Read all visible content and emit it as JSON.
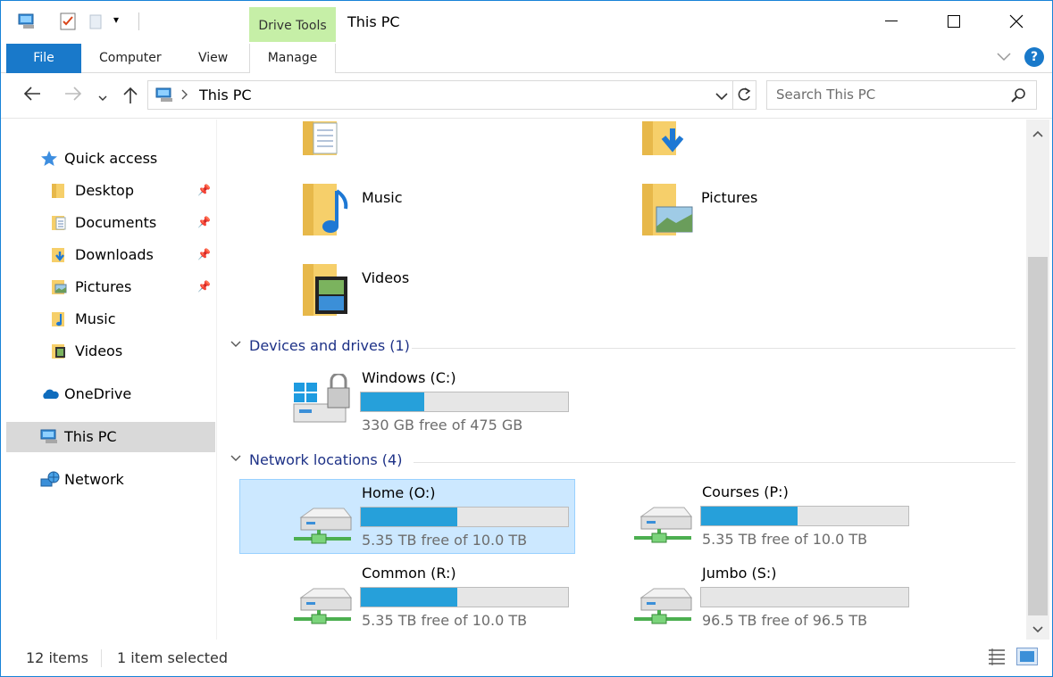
{
  "window": {
    "title": "This PC",
    "context_tab": "Drive Tools",
    "accent": "#1979ca",
    "context_color": "#c6efa7"
  },
  "ribbon": {
    "tabs": [
      {
        "label": "File"
      },
      {
        "label": "Computer"
      },
      {
        "label": "View"
      },
      {
        "label": "Manage"
      }
    ],
    "help": "?"
  },
  "address": {
    "path": "This PC",
    "search_placeholder": "Search This PC"
  },
  "sidebar": {
    "quick_access": "Quick access",
    "pinned": [
      {
        "label": "Desktop",
        "icon": "desktop-folder-icon"
      },
      {
        "label": "Documents",
        "icon": "documents-folder-icon"
      },
      {
        "label": "Downloads",
        "icon": "downloads-folder-icon"
      },
      {
        "label": "Pictures",
        "icon": "pictures-folder-icon"
      }
    ],
    "recent": [
      {
        "label": "Music",
        "icon": "music-folder-icon"
      },
      {
        "label": "Videos",
        "icon": "videos-folder-icon"
      }
    ],
    "onedrive": "OneDrive",
    "this_pc": "This PC",
    "network": "Network"
  },
  "content": {
    "folders": [
      {
        "label": "Music"
      },
      {
        "label": "Pictures"
      },
      {
        "label": "Videos"
      }
    ],
    "devices_header": "Devices and drives (1)",
    "devices": [
      {
        "name": "Windows (C:)",
        "free": "330 GB free of 475 GB",
        "used_fraction": 0.305
      }
    ],
    "network_header": "Network locations (4)",
    "network_drives": [
      {
        "name": "Home (O:)",
        "free": "5.35 TB free of 10.0 TB",
        "used_fraction": 0.465,
        "selected": true
      },
      {
        "name": "Courses (P:)",
        "free": "5.35 TB free of 10.0 TB",
        "used_fraction": 0.465,
        "selected": false
      },
      {
        "name": "Common (R:)",
        "free": "5.35 TB free of 10.0 TB",
        "used_fraction": 0.465,
        "selected": false
      },
      {
        "name": "Jumbo (S:)",
        "free": "96.5 TB free of 96.5 TB",
        "used_fraction": 0.0,
        "selected": false
      }
    ]
  },
  "status": {
    "count": "12 items",
    "selection": "1 item selected"
  }
}
